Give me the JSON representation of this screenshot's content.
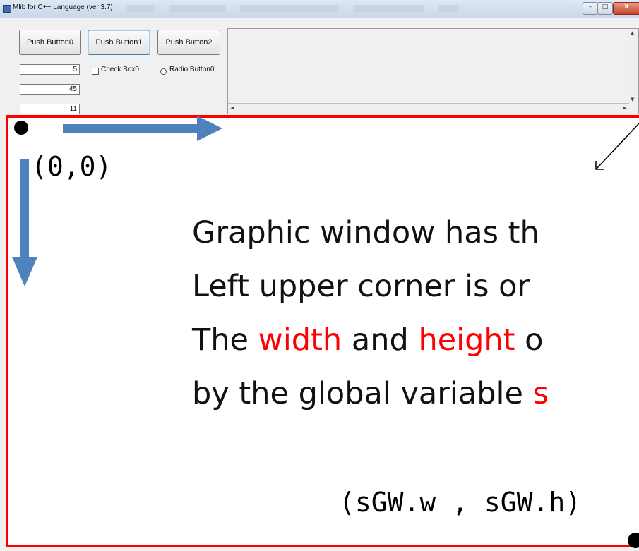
{
  "window": {
    "title": "Mlib for C++ Language  (ver 3.7)"
  },
  "titlebar_buttons": {
    "minimize": "–",
    "maximize": "□",
    "close": "X"
  },
  "buttons": [
    "Push Button0",
    "Push Button1",
    "Push Button2"
  ],
  "fields": [
    "5",
    "45",
    "11"
  ],
  "checkbox": {
    "label": "Check Box0"
  },
  "radio": {
    "label": "Radio Button0"
  },
  "graphic": {
    "origin_label": "(0,0)",
    "description": {
      "line1": "Graphic window has th",
      "line2": "Left upper corner is or",
      "line3_a": "The ",
      "line3_b": "width",
      "line3_c": " and ",
      "line3_d": "height",
      "line3_e": " o",
      "line4_a": "by the global variable ",
      "line4_b": "s"
    },
    "size_label": "(sGW.w , sGW.h)"
  },
  "colors": {
    "accent_red": "#ff0000",
    "arrow_blue": "#4f81bd"
  }
}
